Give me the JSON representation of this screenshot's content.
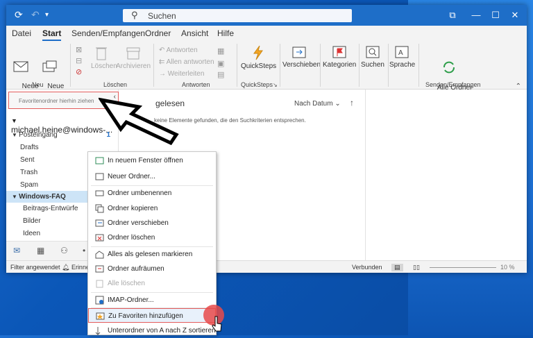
{
  "titlebar": {
    "search_text": "Suchen",
    "icons": [
      "refresh-icon",
      "undo-icon",
      "chevron-down-icon",
      "ribbon-display-icon",
      "minimize-icon",
      "maximize-icon",
      "close-icon"
    ]
  },
  "menu": {
    "tabs": [
      "Datei",
      "Start",
      "Senden/Empfangen",
      "Ordner",
      "Ansicht",
      "Hilfe"
    ],
    "active": "Start"
  },
  "ribbon": {
    "new_email": "Neue\nE-Mail",
    "new_items": "Neue\nElemente",
    "delete": "Löschen",
    "archive": "Archivieren",
    "reply": "Antworten",
    "reply_all": "Allen antworten",
    "forward": "Weiterleiten",
    "quicksteps": "QuickSteps",
    "move": "Verschieben",
    "categories": "Kategorien",
    "search": "Suchen",
    "speech": "Sprache",
    "send_all": "Alle Ordner\nsenden/empfangen",
    "groups": {
      "neu": "Neu",
      "loeschen": "Löschen",
      "antworten": "Antworten",
      "quicksteps": "QuickSteps",
      "sendrecv": "Senden/Empfangen"
    },
    "collapse_icon": "chevron-up-icon"
  },
  "folder_pane": {
    "favorites_placeholder": "Favoritenordner hierhin ziehen",
    "account": "michael.heine@windows-...",
    "inbox": "Posteingang",
    "inbox_count": "1",
    "folders": [
      "Drafts",
      "Sent",
      "Trash",
      "Spam"
    ],
    "selected": "Windows-FAQ",
    "subfolders": [
      "Beitrags-Entwürfe",
      "Bilder",
      "Ideen"
    ]
  },
  "list": {
    "tab": "gelesen",
    "sort": "Nach Datum",
    "empty_message": "keine Elemente gefunden, die den Suchkriterien entsprechen."
  },
  "status": {
    "filter": "Filter angewendet",
    "reminder": "Erinnerungen",
    "connected": "Verbunden",
    "zoom": "10 %"
  },
  "context_menu": {
    "items": [
      "In neuem Fenster öffnen",
      "Neuer Ordner...",
      "Ordner umbenennen",
      "Ordner kopieren",
      "Ordner verschieben",
      "Ordner löschen",
      "Alles als gelesen markieren",
      "Ordner aufräumen",
      "Alle löschen",
      "IMAP-Ordner...",
      "Zu Favoriten hinzufügen",
      "Unterordner von A nach Z sortieren"
    ],
    "highlighted": "Zu Favoriten hinzufügen",
    "disabled": "Alle löschen"
  },
  "colors": {
    "accent": "#1e6ec8",
    "highlight_border": "#e35b5b",
    "selected_folder": "#cde4f7"
  }
}
